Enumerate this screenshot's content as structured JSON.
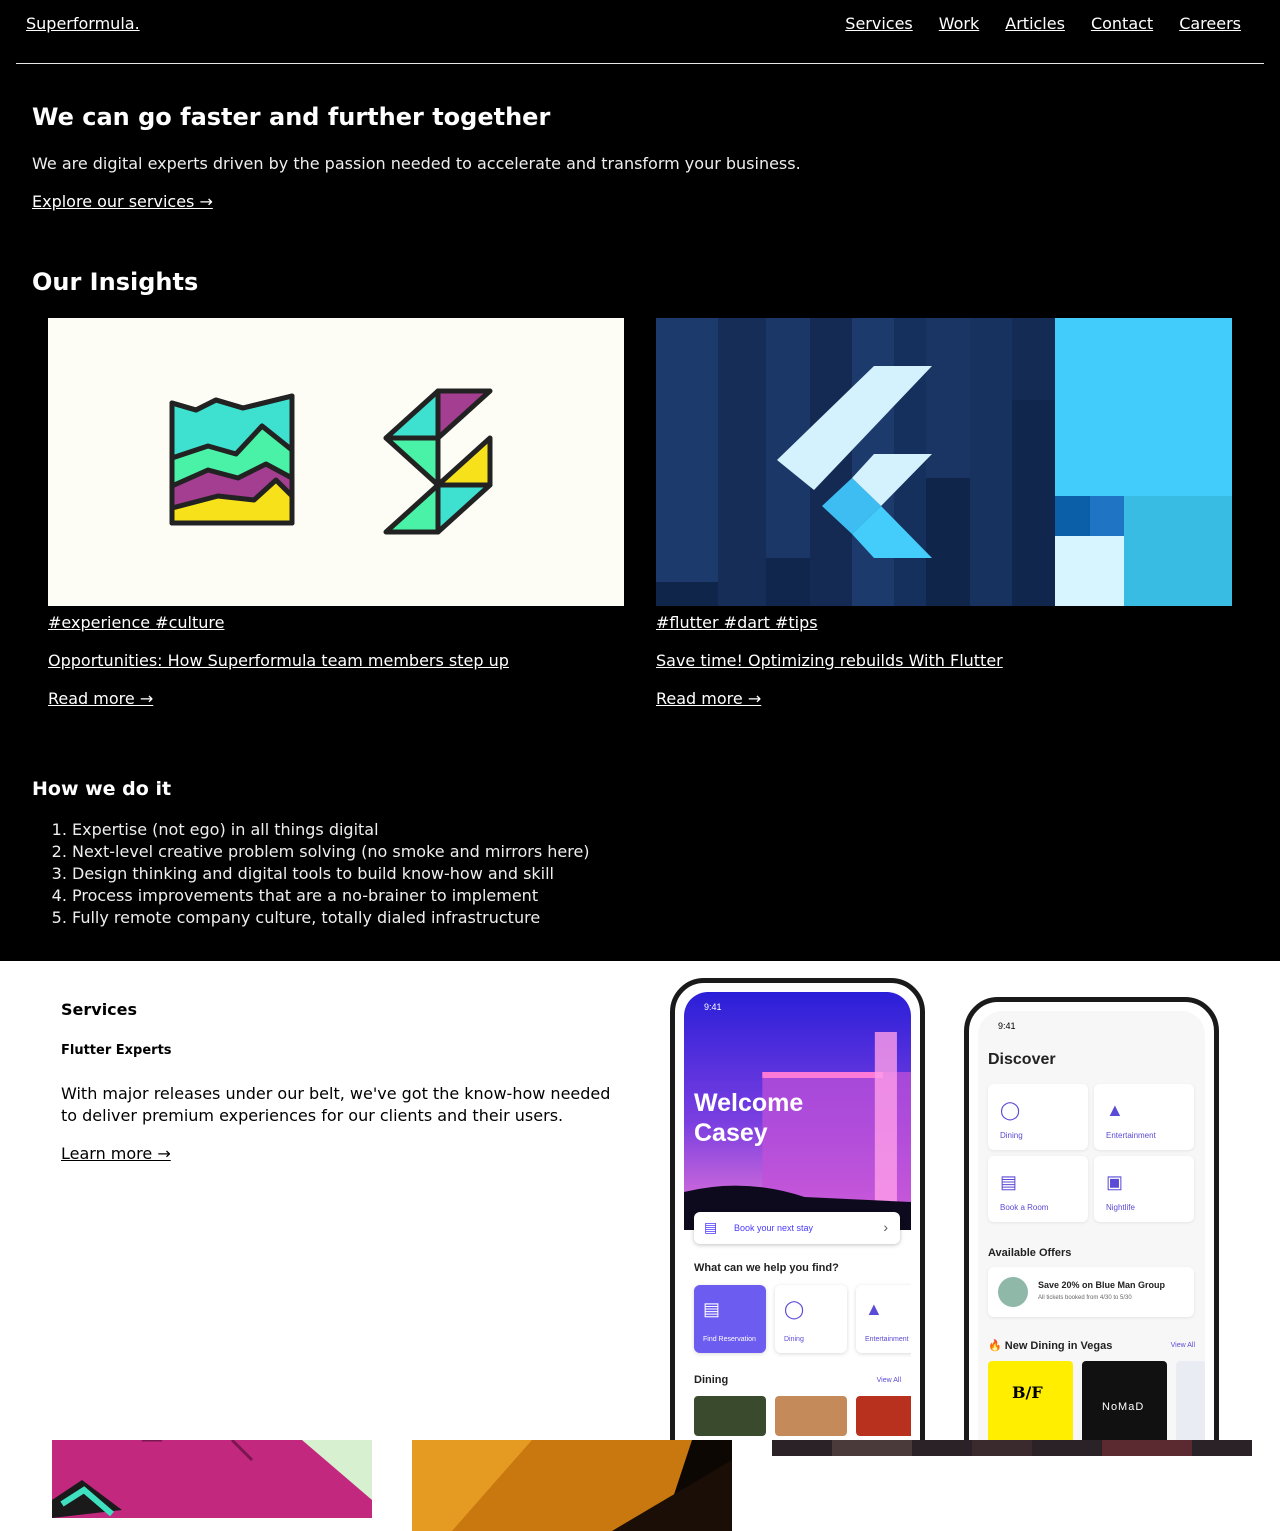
{
  "header": {
    "logo": "Superformula.",
    "nav": [
      "Services",
      "Work",
      "Articles",
      "Contact",
      "Careers"
    ]
  },
  "hero": {
    "title": "We can go faster and further together",
    "subtitle": "We are digital experts driven by the passion needed to accelerate and transform your business.",
    "link": "Explore our services →"
  },
  "insights": {
    "title": "Our Insights",
    "cards": [
      {
        "tags": "#experience #culture",
        "title": "Opportunities: How Superformula team members step up",
        "read_more": "Read more →"
      },
      {
        "tags": "#flutter #dart #tips",
        "title": "Save time! Optimizing rebuilds With Flutter",
        "read_more": "Read more →"
      }
    ]
  },
  "how": {
    "title": "How we do it",
    "items": [
      "Expertise (not ego) in all things digital",
      "Next-level creative problem solving (no smoke and mirrors here)",
      "Design thinking and digital tools to build know-how and skill",
      "Process improvements that are a no-brainer to implement",
      "Fully remote company culture, totally dialed infrastructure"
    ]
  },
  "services": {
    "label": "Services",
    "heading": "Flutter Experts",
    "description": "With major releases under our belt, we've got the know-how needed to deliver premium experiences for our clients and their users.",
    "link": "Learn more →"
  },
  "phone1": {
    "time": "9:41",
    "welcome": "Welcome Casey",
    "book": "Book your next stay",
    "question": "What can we help you find?",
    "tiles": [
      "Find Reservation",
      "Dining",
      "Entertainment"
    ],
    "dining": "Dining",
    "view_all": "View All"
  },
  "phone2": {
    "time": "9:41",
    "discover": "Discover",
    "grid": [
      "Dining",
      "Entertainment",
      "Book a Room",
      "Nightlife"
    ],
    "offers_title": "Available Offers",
    "offer_title": "Save 20% on Blue Man Group",
    "offer_sub": "All tickets booked from 4/30 to 5/30",
    "new_dining": "🔥 New Dining in Vegas",
    "view_all": "View All",
    "brands": [
      "B/F",
      "NoMaD"
    ]
  },
  "colors": {
    "page_bg": "#000000",
    "services_bg": "#ffffff",
    "accent_purple": "#5a4bd6",
    "flutter_blue": "#3fc9fb"
  }
}
